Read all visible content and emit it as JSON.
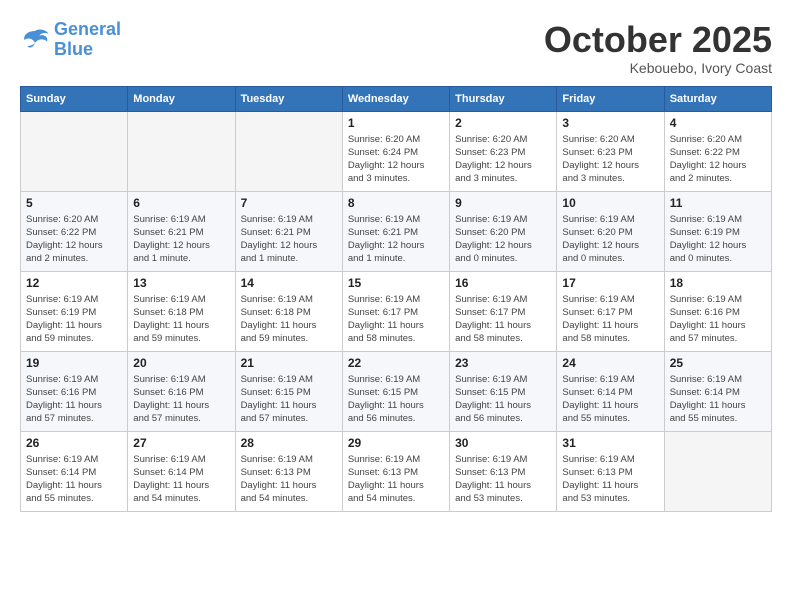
{
  "header": {
    "logo_line1": "General",
    "logo_line2": "Blue",
    "month": "October 2025",
    "location": "Kebouebo, Ivory Coast"
  },
  "weekdays": [
    "Sunday",
    "Monday",
    "Tuesday",
    "Wednesday",
    "Thursday",
    "Friday",
    "Saturday"
  ],
  "weeks": [
    [
      {
        "day": "",
        "info": ""
      },
      {
        "day": "",
        "info": ""
      },
      {
        "day": "",
        "info": ""
      },
      {
        "day": "1",
        "info": "Sunrise: 6:20 AM\nSunset: 6:24 PM\nDaylight: 12 hours\nand 3 minutes."
      },
      {
        "day": "2",
        "info": "Sunrise: 6:20 AM\nSunset: 6:23 PM\nDaylight: 12 hours\nand 3 minutes."
      },
      {
        "day": "3",
        "info": "Sunrise: 6:20 AM\nSunset: 6:23 PM\nDaylight: 12 hours\nand 3 minutes."
      },
      {
        "day": "4",
        "info": "Sunrise: 6:20 AM\nSunset: 6:22 PM\nDaylight: 12 hours\nand 2 minutes."
      }
    ],
    [
      {
        "day": "5",
        "info": "Sunrise: 6:20 AM\nSunset: 6:22 PM\nDaylight: 12 hours\nand 2 minutes."
      },
      {
        "day": "6",
        "info": "Sunrise: 6:19 AM\nSunset: 6:21 PM\nDaylight: 12 hours\nand 1 minute."
      },
      {
        "day": "7",
        "info": "Sunrise: 6:19 AM\nSunset: 6:21 PM\nDaylight: 12 hours\nand 1 minute."
      },
      {
        "day": "8",
        "info": "Sunrise: 6:19 AM\nSunset: 6:21 PM\nDaylight: 12 hours\nand 1 minute."
      },
      {
        "day": "9",
        "info": "Sunrise: 6:19 AM\nSunset: 6:20 PM\nDaylight: 12 hours\nand 0 minutes."
      },
      {
        "day": "10",
        "info": "Sunrise: 6:19 AM\nSunset: 6:20 PM\nDaylight: 12 hours\nand 0 minutes."
      },
      {
        "day": "11",
        "info": "Sunrise: 6:19 AM\nSunset: 6:19 PM\nDaylight: 12 hours\nand 0 minutes."
      }
    ],
    [
      {
        "day": "12",
        "info": "Sunrise: 6:19 AM\nSunset: 6:19 PM\nDaylight: 11 hours\nand 59 minutes."
      },
      {
        "day": "13",
        "info": "Sunrise: 6:19 AM\nSunset: 6:18 PM\nDaylight: 11 hours\nand 59 minutes."
      },
      {
        "day": "14",
        "info": "Sunrise: 6:19 AM\nSunset: 6:18 PM\nDaylight: 11 hours\nand 59 minutes."
      },
      {
        "day": "15",
        "info": "Sunrise: 6:19 AM\nSunset: 6:17 PM\nDaylight: 11 hours\nand 58 minutes."
      },
      {
        "day": "16",
        "info": "Sunrise: 6:19 AM\nSunset: 6:17 PM\nDaylight: 11 hours\nand 58 minutes."
      },
      {
        "day": "17",
        "info": "Sunrise: 6:19 AM\nSunset: 6:17 PM\nDaylight: 11 hours\nand 58 minutes."
      },
      {
        "day": "18",
        "info": "Sunrise: 6:19 AM\nSunset: 6:16 PM\nDaylight: 11 hours\nand 57 minutes."
      }
    ],
    [
      {
        "day": "19",
        "info": "Sunrise: 6:19 AM\nSunset: 6:16 PM\nDaylight: 11 hours\nand 57 minutes."
      },
      {
        "day": "20",
        "info": "Sunrise: 6:19 AM\nSunset: 6:16 PM\nDaylight: 11 hours\nand 57 minutes."
      },
      {
        "day": "21",
        "info": "Sunrise: 6:19 AM\nSunset: 6:15 PM\nDaylight: 11 hours\nand 57 minutes."
      },
      {
        "day": "22",
        "info": "Sunrise: 6:19 AM\nSunset: 6:15 PM\nDaylight: 11 hours\nand 56 minutes."
      },
      {
        "day": "23",
        "info": "Sunrise: 6:19 AM\nSunset: 6:15 PM\nDaylight: 11 hours\nand 56 minutes."
      },
      {
        "day": "24",
        "info": "Sunrise: 6:19 AM\nSunset: 6:14 PM\nDaylight: 11 hours\nand 55 minutes."
      },
      {
        "day": "25",
        "info": "Sunrise: 6:19 AM\nSunset: 6:14 PM\nDaylight: 11 hours\nand 55 minutes."
      }
    ],
    [
      {
        "day": "26",
        "info": "Sunrise: 6:19 AM\nSunset: 6:14 PM\nDaylight: 11 hours\nand 55 minutes."
      },
      {
        "day": "27",
        "info": "Sunrise: 6:19 AM\nSunset: 6:14 PM\nDaylight: 11 hours\nand 54 minutes."
      },
      {
        "day": "28",
        "info": "Sunrise: 6:19 AM\nSunset: 6:13 PM\nDaylight: 11 hours\nand 54 minutes."
      },
      {
        "day": "29",
        "info": "Sunrise: 6:19 AM\nSunset: 6:13 PM\nDaylight: 11 hours\nand 54 minutes."
      },
      {
        "day": "30",
        "info": "Sunrise: 6:19 AM\nSunset: 6:13 PM\nDaylight: 11 hours\nand 53 minutes."
      },
      {
        "day": "31",
        "info": "Sunrise: 6:19 AM\nSunset: 6:13 PM\nDaylight: 11 hours\nand 53 minutes."
      },
      {
        "day": "",
        "info": ""
      }
    ]
  ]
}
